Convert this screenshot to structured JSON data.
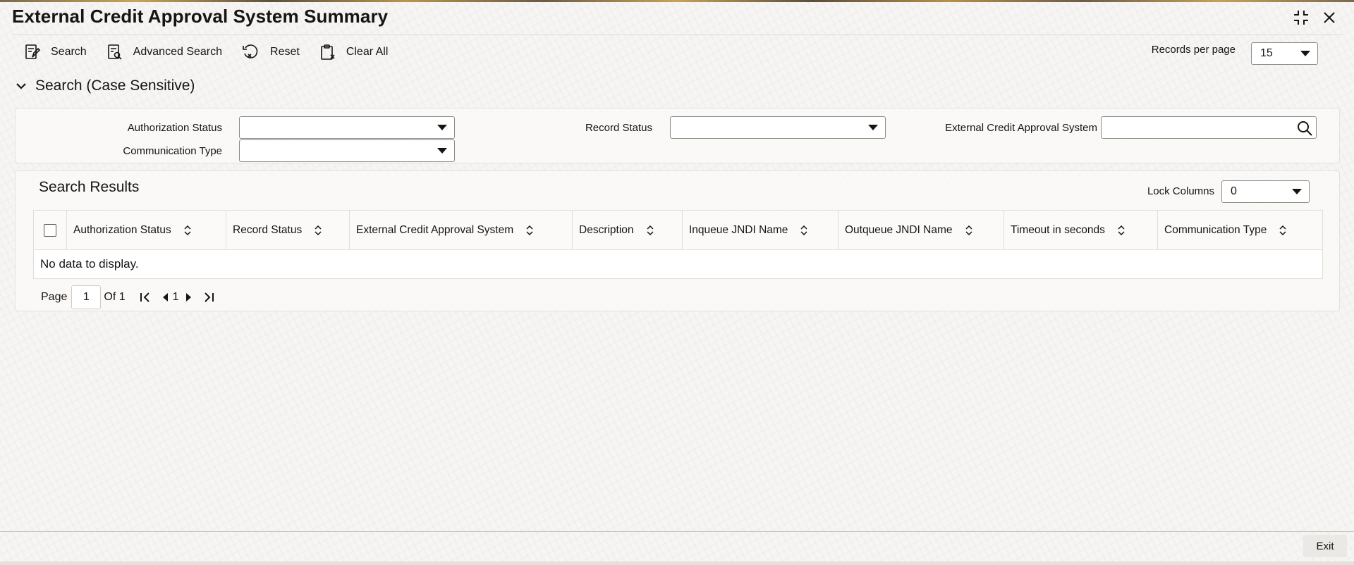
{
  "window": {
    "title": "External Credit Approval System Summary"
  },
  "toolbar": {
    "search_label": "Search",
    "advanced_search_label": "Advanced Search",
    "reset_label": "Reset",
    "clear_all_label": "Clear All",
    "records_per_page_label": "Records per page",
    "records_per_page_value": "15"
  },
  "search_section": {
    "title": "Search (Case Sensitive)",
    "fields": {
      "authorization_status": {
        "label": "Authorization Status",
        "value": ""
      },
      "record_status": {
        "label": "Record Status",
        "value": ""
      },
      "external_credit_approval_system": {
        "label": "External Credit Approval System",
        "value": ""
      },
      "communication_type": {
        "label": "Communication Type",
        "value": ""
      }
    }
  },
  "results": {
    "title": "Search Results",
    "lock_columns_label": "Lock Columns",
    "lock_columns_value": "0",
    "columns": [
      "Authorization Status",
      "Record Status",
      "External Credit Approval System",
      "Description",
      "Inqueue JNDI Name",
      "Outqueue JNDI Name",
      "Timeout in seconds",
      "Communication Type"
    ],
    "empty_message": "No data to display."
  },
  "pagination": {
    "page_label": "Page",
    "current_page": "1",
    "of_label": "Of 1",
    "page_number": "1"
  },
  "footer": {
    "exit_label": "Exit"
  }
}
